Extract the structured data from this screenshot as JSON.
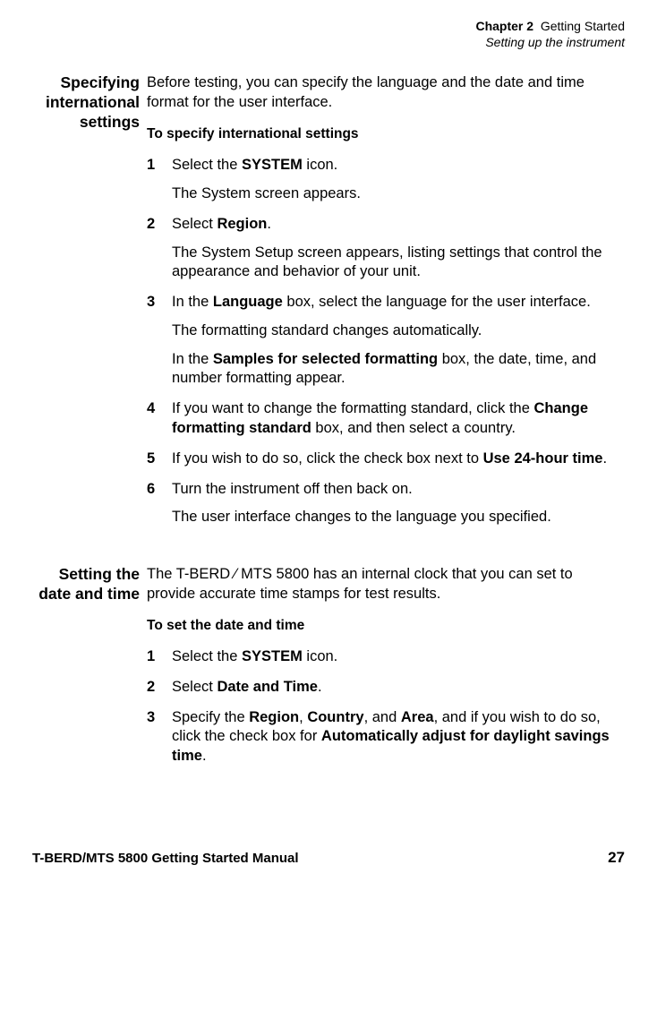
{
  "header": {
    "chapter_label": "Chapter 2",
    "chapter_title": "Getting Started",
    "section_title": "Setting up the instrument"
  },
  "sections": [
    {
      "heading": "Specifying international settings",
      "intro": "Before testing, you can specify the language and the date and time format for the user interface.",
      "subheading": "To specify international settings",
      "steps": [
        {
          "num": "1",
          "lines": [
            {
              "parts": [
                "Select the ",
                {
                  "b": "SYSTEM"
                },
                " icon."
              ]
            },
            {
              "parts": [
                "The System screen appears."
              ]
            }
          ]
        },
        {
          "num": "2",
          "lines": [
            {
              "parts": [
                "Select ",
                {
                  "b": "Region"
                },
                "."
              ]
            },
            {
              "parts": [
                "The System Setup screen appears, listing settings that control the appearance and behavior of your unit."
              ]
            }
          ]
        },
        {
          "num": "3",
          "lines": [
            {
              "parts": [
                "In the ",
                {
                  "b": "Language"
                },
                " box, select the language for the user interface."
              ]
            },
            {
              "parts": [
                "The formatting standard changes automatically."
              ]
            },
            {
              "parts": [
                "In the ",
                {
                  "b": "Samples for selected formatting"
                },
                " box, the date, time, and number formatting appear."
              ]
            }
          ]
        },
        {
          "num": "4",
          "lines": [
            {
              "parts": [
                "If you want to change the formatting standard, click the ",
                {
                  "b": "Change formatting standard"
                },
                " box, and then select a country."
              ]
            }
          ]
        },
        {
          "num": "5",
          "lines": [
            {
              "parts": [
                "If you wish to do so, click the check box next to ",
                {
                  "b": "Use 24-hour time"
                },
                "."
              ]
            }
          ]
        },
        {
          "num": "6",
          "lines": [
            {
              "parts": [
                "Turn the instrument off then back on."
              ]
            },
            {
              "parts": [
                "The user interface changes to the language you specified."
              ]
            }
          ]
        }
      ]
    },
    {
      "heading": "Setting the date and time",
      "intro": "The T-BERD ⁄ MTS 5800 has an internal clock that you can set to provide accurate time stamps for test results.",
      "subheading": "To set the date and time",
      "steps": [
        {
          "num": "1",
          "lines": [
            {
              "parts": [
                "Select the ",
                {
                  "b": "SYSTEM"
                },
                " icon."
              ]
            }
          ]
        },
        {
          "num": "2",
          "lines": [
            {
              "parts": [
                "Select ",
                {
                  "b": "Date and Time"
                },
                "."
              ]
            }
          ]
        },
        {
          "num": "3",
          "lines": [
            {
              "parts": [
                "Specify the ",
                {
                  "b": "Region"
                },
                ", ",
                {
                  "b": "Country"
                },
                ", and ",
                {
                  "b": "Area"
                },
                ", and if you wish to do so, click the check box for ",
                {
                  "b": "Automatically adjust for daylight savings time"
                },
                "."
              ]
            }
          ]
        }
      ]
    }
  ],
  "footer": {
    "manual": "T-BERD/MTS 5800 Getting Started Manual",
    "page": "27"
  }
}
